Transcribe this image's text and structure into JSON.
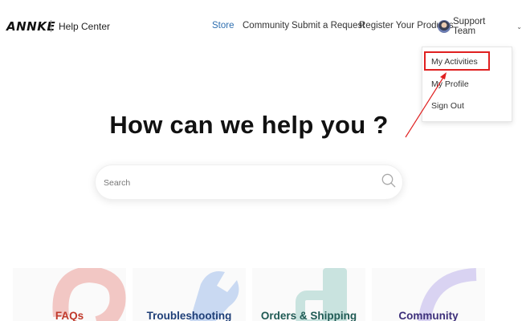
{
  "header": {
    "logo": "ANNKE",
    "site_name": "Help Center",
    "nav": [
      {
        "label": "Store",
        "active": true
      },
      {
        "label": "Community",
        "active": false
      },
      {
        "label": "Submit a Request",
        "active": false
      },
      {
        "label": "Register Your Products",
        "active": false
      }
    ],
    "user": {
      "name": "Support Team",
      "avatar_icon": "avatar-icon",
      "menu_icon": "chevron-down-icon"
    }
  },
  "user_menu": {
    "items": [
      {
        "label": "My Activities",
        "highlighted": true
      },
      {
        "label": "My Profile",
        "highlighted": false
      },
      {
        "label": "Sign Out",
        "highlighted": false
      }
    ],
    "highlight_color": "#e02020"
  },
  "hero": {
    "title": "How can we help you ?",
    "search": {
      "placeholder": "Search",
      "value": "",
      "icon": "search-icon"
    }
  },
  "categories": [
    {
      "label": "FAQs",
      "color": "#c0392b",
      "art_color": "#f2c7c4"
    },
    {
      "label": "Troubleshooting",
      "color": "#1f3f78",
      "art_color": "#c9d9f2"
    },
    {
      "label": "Orders & Shipping",
      "color": "#1f5a54",
      "art_color": "#c9e3df"
    },
    {
      "label": "Community",
      "color": "#3d2f7a",
      "art_color": "#d9d3f2"
    }
  ],
  "colors": {
    "accent": "#2f6fb0",
    "annotation": "#e02020"
  }
}
